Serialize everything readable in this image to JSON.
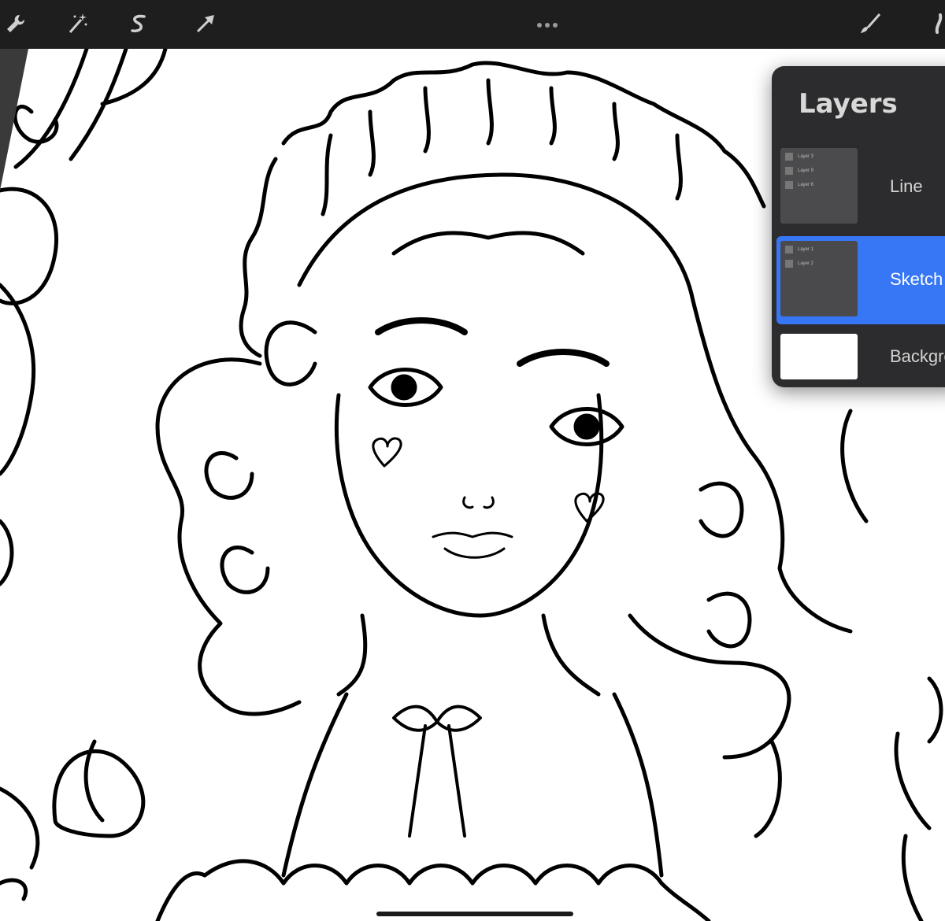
{
  "toolbar": {
    "left_tools": [
      "wrench-icon",
      "magic-wand-icon",
      "selection-s-icon",
      "arrow-transform-icon"
    ],
    "right_tools": [
      "brush-icon",
      "smudge-icon"
    ],
    "menu": "more-dots-icon"
  },
  "layers_panel": {
    "title": "Layers",
    "layers": [
      {
        "label": "Line",
        "selected": false,
        "group_items": [
          "Layer 3",
          "Layer 9",
          "Layer 6"
        ]
      },
      {
        "label": "Sketch",
        "selected": true,
        "group_items": [
          "Layer 1",
          "Layer 2"
        ]
      },
      {
        "label": "Background",
        "selected": false,
        "group_items": []
      }
    ],
    "selected_color": "#3777f6"
  },
  "canvas": {
    "content": "line-art-illustration"
  }
}
